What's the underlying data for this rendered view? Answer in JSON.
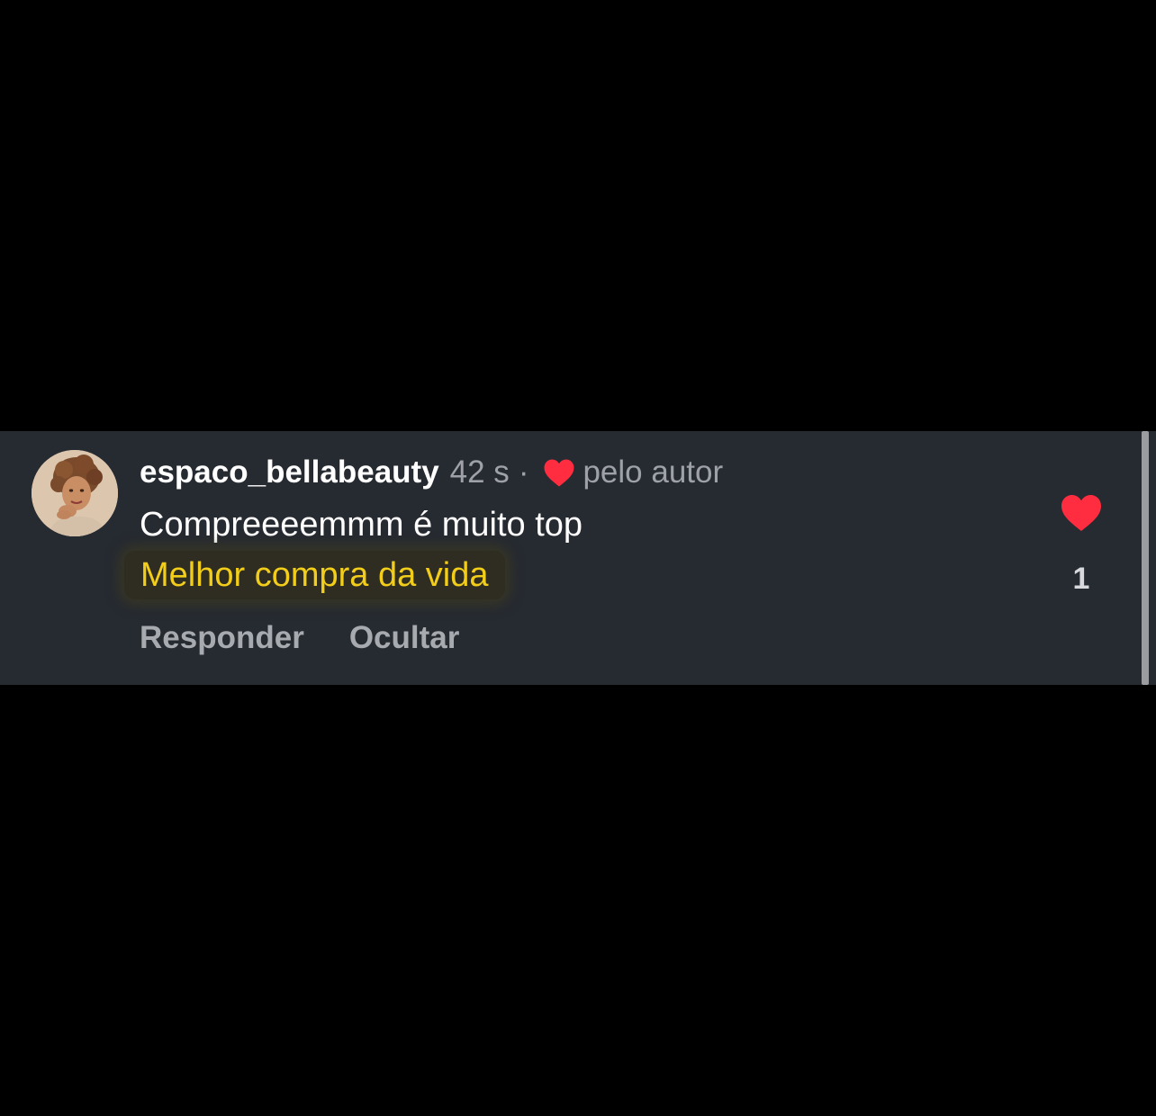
{
  "comment": {
    "username": "espaco_bellabeauty",
    "time": "42 s",
    "separator": "·",
    "liked_by_author_label": "pelo autor",
    "text_line1": "Compreeeemmm é muito top",
    "text_line2": "Melhor compra da vida",
    "reply_label": "Responder",
    "hide_label": "Ocultar",
    "like_count": "1",
    "avatar_icon": "profile-photo",
    "like_icon": "heart-icon",
    "author_like_icon": "heart-icon"
  },
  "colors": {
    "background": "#000000",
    "card": "#262a31",
    "heart": "#ff2d3f",
    "highlight_text": "#f2cd1a",
    "muted_text": "#9ea1a7"
  }
}
